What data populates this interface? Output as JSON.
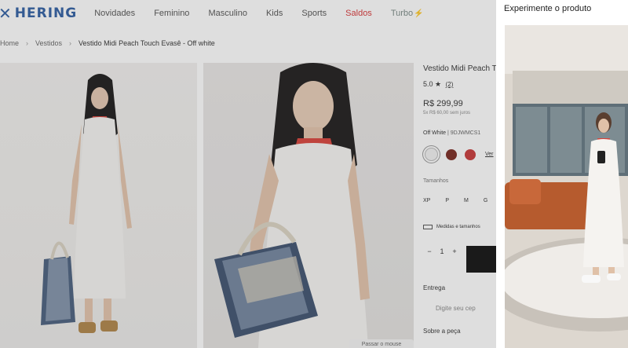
{
  "brand": {
    "logo_mark": "✕",
    "logo_text": "HERING",
    "brand_color": "#2f5fa3"
  },
  "nav": {
    "items": [
      "Novidades",
      "Feminino",
      "Masculino",
      "Kids",
      "Sports"
    ],
    "sale_label": "Saldos",
    "turbo_label": "Turbo",
    "sale_color": "#d9383a"
  },
  "breadcrumb": {
    "home": "Home",
    "category": "Vestidos",
    "current": "Vestido Midi Peach Touch Evasê - Off white"
  },
  "product": {
    "title": "Vestido Midi Peach T",
    "rating": "5.0",
    "rating_count": "(2)",
    "price": "R$ 299,99",
    "installments": "5x R$ 60,00 sem juros",
    "color_name": "Off White",
    "color_code": "| 9DJWMCS1",
    "swatch_colors": [
      "#f2f2f2",
      "#7a2a22",
      "#c83a3a"
    ],
    "see_more": "Ver",
    "sizes_label": "Tamanhos",
    "sizes": [
      "XP",
      "P",
      "M",
      "G"
    ],
    "measure_label": "Medidas e tamanhos",
    "qty_minus": "−",
    "qty_value": "1",
    "qty_plus": "+",
    "delivery_label": "Entrega",
    "cep_placeholder": "Digite seu cep",
    "about_label": "Sobre a peça"
  },
  "gallery": {
    "zoom_label": "Passar o mouse"
  },
  "tryon_panel": {
    "title": "Experimente o produto"
  }
}
